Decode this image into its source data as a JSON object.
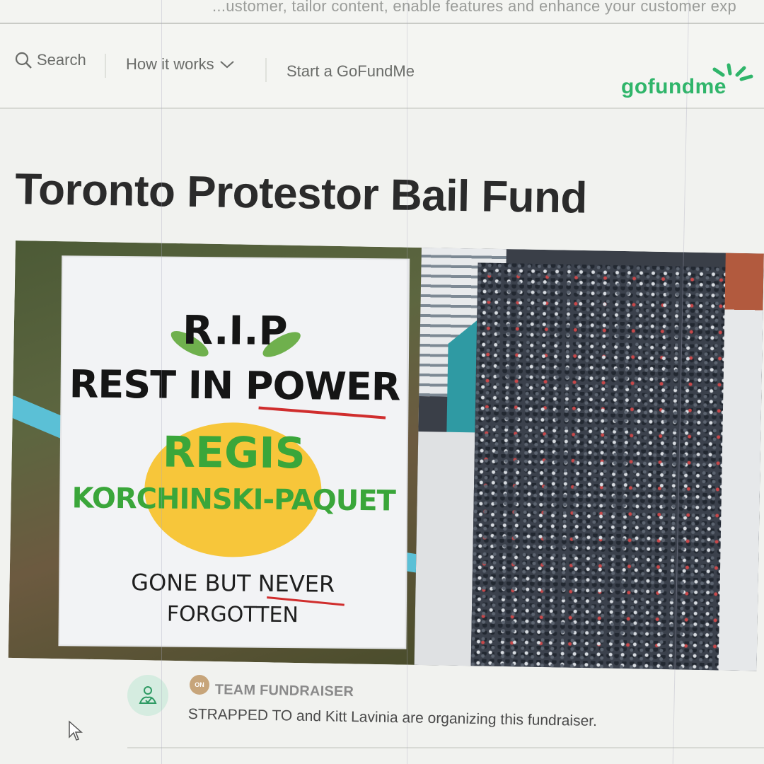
{
  "cookie_banner": {
    "text": "...ustomer, tailor content, enable features and enhance your customer exp"
  },
  "header": {
    "search_label": "Search",
    "how_it_works_label": "How it works",
    "start_label": "Start a GoFundMe",
    "logo_text": "gofundme"
  },
  "campaign": {
    "title": "Toronto Protestor Bail Fund",
    "image_sign": {
      "line1": "R.I.P",
      "line2": "REST IN POWER",
      "line3": "REGIS",
      "line4": "KORCHINSKI-PAQUET",
      "line5": "GONE BUT NEVER",
      "line6": "FORGOTTEN"
    },
    "organizer": {
      "badge_text": "TEAM FUNDRAISER",
      "description": "STRAPPED TO and Kitt Lavinia are organizing this fundraiser."
    }
  },
  "colors": {
    "brand_green": "#2fb56a",
    "title": "#2b2b2b",
    "background": "#f1f2ef"
  }
}
